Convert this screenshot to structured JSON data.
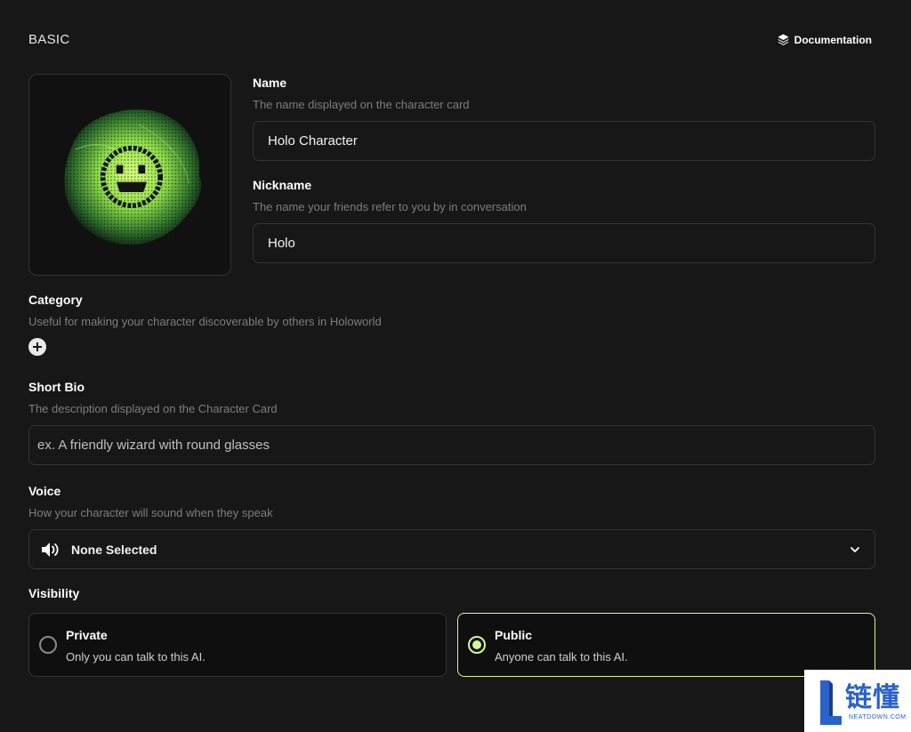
{
  "header": {
    "section_title": "BASIC",
    "doc_link_label": "Documentation",
    "doc_icon": "layers-icon"
  },
  "avatar": {
    "icon": "holo-smiley-avatar",
    "accent_color": "#a8f25a"
  },
  "name_field": {
    "label": "Name",
    "description": "The name displayed on the character card",
    "value": "Holo Character"
  },
  "nickname_field": {
    "label": "Nickname",
    "description": "The name your friends refer to you by in conversation",
    "value": "Holo"
  },
  "category": {
    "label": "Category",
    "description": "Useful for making your character discoverable by others in Holoworld",
    "add_icon": "plus-circle-icon"
  },
  "short_bio": {
    "label": "Short Bio",
    "description": "The description displayed on the Character Card",
    "placeholder": "ex. A friendly wizard with round glasses"
  },
  "voice": {
    "label": "Voice",
    "description": "How your character will sound when they speak",
    "selected": "None Selected",
    "icon": "speaker-icon"
  },
  "visibility": {
    "label": "Visibility",
    "options": [
      {
        "title": "Private",
        "description": "Only you can talk to this AI.",
        "selected": false
      },
      {
        "title": "Public",
        "description": "Anyone can talk to this AI.",
        "selected": true
      }
    ],
    "selected_color": "#d9f59a"
  },
  "watermark": {
    "text_cn": "链懂",
    "text_en": "NEATDOWN.COM"
  }
}
